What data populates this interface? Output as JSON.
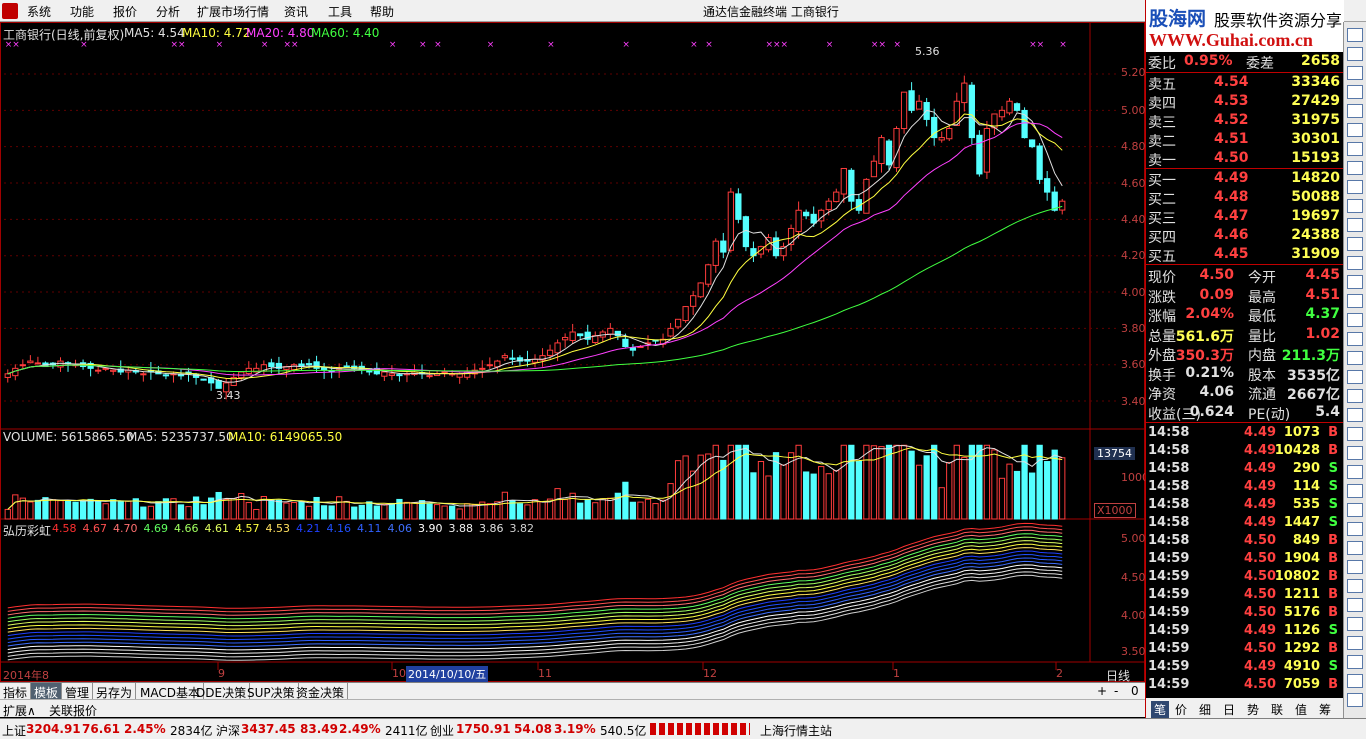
{
  "menu": {
    "items": [
      "系统",
      "功能",
      "报价",
      "分析",
      "扩展市场行情",
      "资讯",
      "工具",
      "帮助"
    ],
    "title": "通达信金融终端   工商银行",
    "window_controls": "_ ▫ ✕"
  },
  "kline": {
    "title": "工商银行(日线,前复权)",
    "ma5": "MA5: 4.54",
    "ma10": "MA10: 4.72",
    "ma20": "MA20: 4.80",
    "ma60": "MA60: 4.40",
    "high_label": "5.36",
    "low_label": "3.43",
    "price_axis": [
      "5.20",
      "5.00",
      "4.80",
      "4.60",
      "4.40",
      "4.20",
      "4.00",
      "3.80",
      "3.60",
      "3.40"
    ],
    "closes": [
      3.55,
      3.58,
      3.6,
      3.62,
      3.61,
      3.59,
      3.6,
      3.62,
      3.61,
      3.6,
      3.59,
      3.58,
      3.57,
      3.58,
      3.57,
      3.56,
      3.57,
      3.56,
      3.55,
      3.56,
      3.55,
      3.54,
      3.55,
      3.54,
      3.55,
      3.53,
      3.52,
      3.5,
      3.47,
      3.5,
      3.53,
      3.56,
      3.58,
      3.58,
      3.6,
      3.59,
      3.58,
      3.59,
      3.6,
      3.59,
      3.6,
      3.58,
      3.57,
      3.56,
      3.58,
      3.59,
      3.58,
      3.57,
      3.56,
      3.55,
      3.56,
      3.55,
      3.54,
      3.55,
      3.56,
      3.55,
      3.54,
      3.55,
      3.56,
      3.55,
      3.55,
      3.56,
      3.57,
      3.58,
      3.6,
      3.62,
      3.65,
      3.63,
      3.62,
      3.62,
      3.63,
      3.65,
      3.68,
      3.72,
      3.75,
      3.78,
      3.76,
      3.74,
      3.76,
      3.78,
      3.8,
      3.76,
      3.7,
      3.68,
      3.7,
      3.72,
      3.73,
      3.74,
      3.8,
      3.85,
      3.92,
      3.98,
      4.05,
      4.15,
      4.28,
      4.22,
      4.55,
      4.4,
      4.25,
      4.2,
      4.25,
      4.3,
      4.2,
      4.25,
      4.35,
      4.45,
      4.42,
      4.38,
      4.45,
      4.5,
      4.55,
      4.68,
      4.5,
      4.45,
      4.62,
      4.72,
      4.85,
      4.7,
      4.9,
      5.1,
      5.0,
      5.05,
      4.95,
      4.85,
      4.85,
      4.9,
      5.05,
      5.15,
      4.85,
      4.65,
      4.9,
      4.98,
      5.0,
      5.05,
      5.0,
      4.85,
      4.8,
      4.62,
      4.55,
      4.45,
      4.5
    ]
  },
  "volume": {
    "label": "VOLUME: 5615865.50",
    "ma5": "MA5: 5235737.50",
    "ma10": "MA10: 6149065.50",
    "axis_top": "13754",
    "axis_mid": "10000",
    "unit": "X1000"
  },
  "rainbow": {
    "title": "弘历彩虹",
    "values": [
      "4.58",
      "4.67",
      "4.70",
      "4.69",
      "4.66",
      "4.61",
      "4.57",
      "4.53",
      "4.21",
      "4.16",
      "4.11",
      "4.06",
      "3.90",
      "3.88",
      "3.86",
      "3.82"
    ],
    "colors": [
      "#ff3030",
      "#ff5050",
      "#ff7070",
      "#60ff60",
      "#a0ff60",
      "#e0ff60",
      "#ffff40",
      "#ffe060",
      "#2040ff",
      "#2050ff",
      "#3060ff",
      "#4070ff",
      "#ffffff",
      "#f0f0f0",
      "#e0e0e0",
      "#d0d0d0"
    ],
    "axis": [
      "5.00",
      "4.50",
      "4.00",
      "3.50"
    ]
  },
  "dates": {
    "labels": [
      "2014年8",
      "9",
      "10",
      "11",
      "12",
      "1",
      "2"
    ],
    "cursor": "2014/10/10/五",
    "period": "日线"
  },
  "tabs": [
    "指标",
    "模板",
    "管理",
    "另存为",
    "MACD基本",
    "DDE决策",
    "SUP决策",
    "资金决策"
  ],
  "tabs2": [
    "扩展∧",
    "关联报价"
  ],
  "zoom": [
    "+",
    "-",
    "0"
  ],
  "logo": {
    "brand": "股海网",
    "slogan": "股票软件资源分享",
    "url": "WWW.Guhai.com.cn"
  },
  "orderbook": {
    "weibi_label": "委比",
    "weibi": "0.95%",
    "weicha_label": "委差",
    "weicha": "2658",
    "sells": [
      {
        "l": "卖五",
        "p": "4.54",
        "v": "33346"
      },
      {
        "l": "卖四",
        "p": "4.53",
        "v": "27429"
      },
      {
        "l": "卖三",
        "p": "4.52",
        "v": "31975"
      },
      {
        "l": "卖二",
        "p": "4.51",
        "v": "30301"
      },
      {
        "l": "卖一",
        "p": "4.50",
        "v": "15193"
      }
    ],
    "buys": [
      {
        "l": "买一",
        "p": "4.49",
        "v": "14820"
      },
      {
        "l": "买二",
        "p": "4.48",
        "v": "50088"
      },
      {
        "l": "买三",
        "p": "4.47",
        "v": "19697"
      },
      {
        "l": "买四",
        "p": "4.46",
        "v": "24388"
      },
      {
        "l": "买五",
        "p": "4.45",
        "v": "31909"
      }
    ]
  },
  "quote": [
    [
      "现价",
      "4.50",
      "今开",
      "4.45"
    ],
    [
      "涨跌",
      "0.09",
      "最高",
      "4.51"
    ],
    [
      "涨幅",
      "2.04%",
      "最低",
      "4.37"
    ],
    [
      "总量",
      "561.6万",
      "量比",
      "1.02"
    ],
    [
      "外盘",
      "350.3万",
      "内盘",
      "211.3万"
    ],
    [
      "换手",
      "0.21%",
      "股本",
      "3535亿"
    ],
    [
      "净资",
      "4.06",
      "流通",
      "2667亿"
    ],
    [
      "收益(三)",
      "0.624",
      "PE(动)",
      "5.4"
    ]
  ],
  "ticks": [
    [
      "14:58",
      "4.49",
      "1073",
      "B"
    ],
    [
      "14:58",
      "4.49",
      "10428",
      "B"
    ],
    [
      "14:58",
      "4.49",
      "290",
      "S"
    ],
    [
      "14:58",
      "4.49",
      "114",
      "S"
    ],
    [
      "14:58",
      "4.49",
      "535",
      "S"
    ],
    [
      "14:58",
      "4.49",
      "1447",
      "S"
    ],
    [
      "14:58",
      "4.50",
      "849",
      "B"
    ],
    [
      "14:59",
      "4.50",
      "1904",
      "B"
    ],
    [
      "14:59",
      "4.50",
      "10802",
      "B"
    ],
    [
      "14:59",
      "4.50",
      "1211",
      "B"
    ],
    [
      "14:59",
      "4.50",
      "5176",
      "B"
    ],
    [
      "14:59",
      "4.49",
      "1126",
      "S"
    ],
    [
      "14:59",
      "4.50",
      "1292",
      "B"
    ],
    [
      "14:59",
      "4.49",
      "4910",
      "S"
    ],
    [
      "14:59",
      "4.50",
      "7059",
      "B"
    ]
  ],
  "rtabs": [
    "笔",
    "价",
    "细",
    "日",
    "势",
    "联",
    "值",
    "筹"
  ],
  "status": {
    "sh_label": "上证",
    "sh": "3204.91",
    "sh_chg": "76.61",
    "sh_pct": "2.45%",
    "sh_amt": "2834亿",
    "sz_label": "沪深",
    "sz": "3437.45",
    "sz_chg": "83.49",
    "sz_pct": "2.49%",
    "sz_amt": "2411亿",
    "cy_label": "创业",
    "cy": "1750.91",
    "cy_chg": "54.08",
    "cy_pct": "3.19%",
    "cy_amt": "540.5亿",
    "server": "上海行情主站"
  }
}
